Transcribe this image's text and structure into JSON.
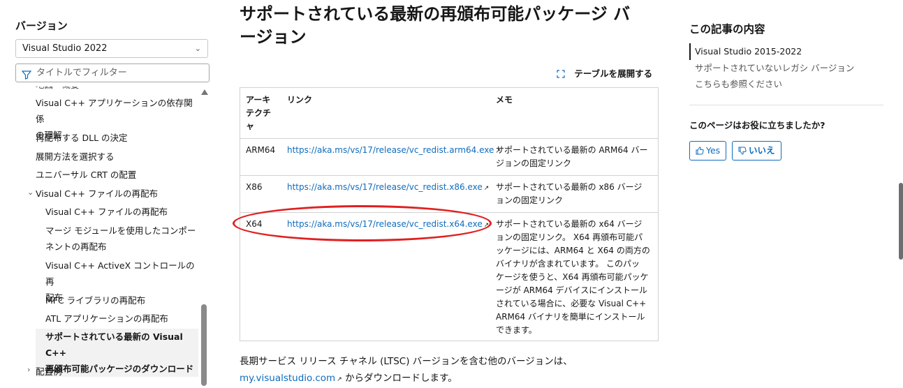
{
  "sidebar": {
    "version_label": "バージョン",
    "version_selected": "Visual Studio 2022",
    "filter_placeholder": "タイトルでフィルター",
    "toc_cut_top": "地図 - 概要",
    "items": [
      {
        "label_1": "Visual C++ アプリケーションの依存関係",
        "label_2": "の理解"
      },
      {
        "label": "再配布する DLL の決定"
      },
      {
        "label": "展開方法を選択する"
      },
      {
        "label": "ユニバーサル CRT の配置"
      },
      {
        "label": "Visual C++ ファイルの再配布"
      },
      {
        "label": "Visual C++ ファイルの再配布"
      },
      {
        "label_1": "マージ モジュールを使用したコンポー",
        "label_2": "ネントの再配布"
      },
      {
        "label_1": "Visual C++ ActiveX コントロールの再",
        "label_2": "配布"
      },
      {
        "label": "MFC ライブラリの再配布"
      },
      {
        "label": "ATL アプリケーションの再配布"
      },
      {
        "label_1": "サポートされている最新の Visual C++",
        "label_2": "再頒布可能パッケージのダウンロード"
      },
      {
        "label": "配置例"
      }
    ]
  },
  "main": {
    "title_1": "サポートされている最新の再頒布可能パッケージ バ",
    "title_2": "ージョン",
    "expand_table": "テーブルを展開する",
    "table": {
      "headers": {
        "arch_1": "アーキ",
        "arch_2": "テクチ",
        "arch_3": "ャ",
        "link": "リンク",
        "memo": "メモ"
      },
      "rows": [
        {
          "arch": "ARM64",
          "link": "https://aka.ms/vs/17/release/vc_redist.arm64.exe",
          "memo": [
            "サポートされている最新の ARM64 バー",
            "ジョンの固定リンク"
          ]
        },
        {
          "arch": "X86",
          "link": "https://aka.ms/vs/17/release/vc_redist.x86.exe",
          "memo": [
            "サポートされている最新の x86 バージ",
            "ョンの固定リンク"
          ]
        },
        {
          "arch": "X64",
          "link": "https://aka.ms/vs/17/release/vc_redist.x64.exe",
          "memo": [
            "サポートされている最新の x64 バージ",
            "ョンの固定リンク。 X64 再頒布可能パ",
            "ッケージには、ARM64 と X64 の両方の",
            "バイナリが含まれています。 このパッ",
            "ケージを使うと、X64 再頒布可能パッケ",
            "ージが ARM64 デバイスにインストール",
            "されている場合に、必要な Visual C++",
            "ARM64 バイナリを簡単にインストール",
            "できます。"
          ]
        }
      ]
    },
    "para_line1": "長期サービス リリース チャネル (LTSC) バージョンを含む他のバージョンは、",
    "para_link": "my.visualstudio.com",
    "para_rest": " からダウンロードします。"
  },
  "right": {
    "in_article_title": "この記事の内容",
    "in_article": [
      "Visual Studio 2015-2022",
      "サポートされていないレガシ バージョン",
      "こちらも参照ください"
    ],
    "feedback_question": "このページはお役に立ちましたか?",
    "yes": "Yes",
    "no": "いいえ"
  },
  "colors": {
    "link": "#0f6cbd",
    "highlight_oval": "#e02020",
    "active_bg": "#f2f2f2"
  },
  "icons": [
    "chevron-down-icon",
    "filter-icon",
    "chevron-down-icon",
    "chevron-right-icon",
    "expand-icon",
    "external-link-icon",
    "thumbs-up-icon",
    "thumbs-down-icon",
    "scroll-up-arrow-icon"
  ]
}
